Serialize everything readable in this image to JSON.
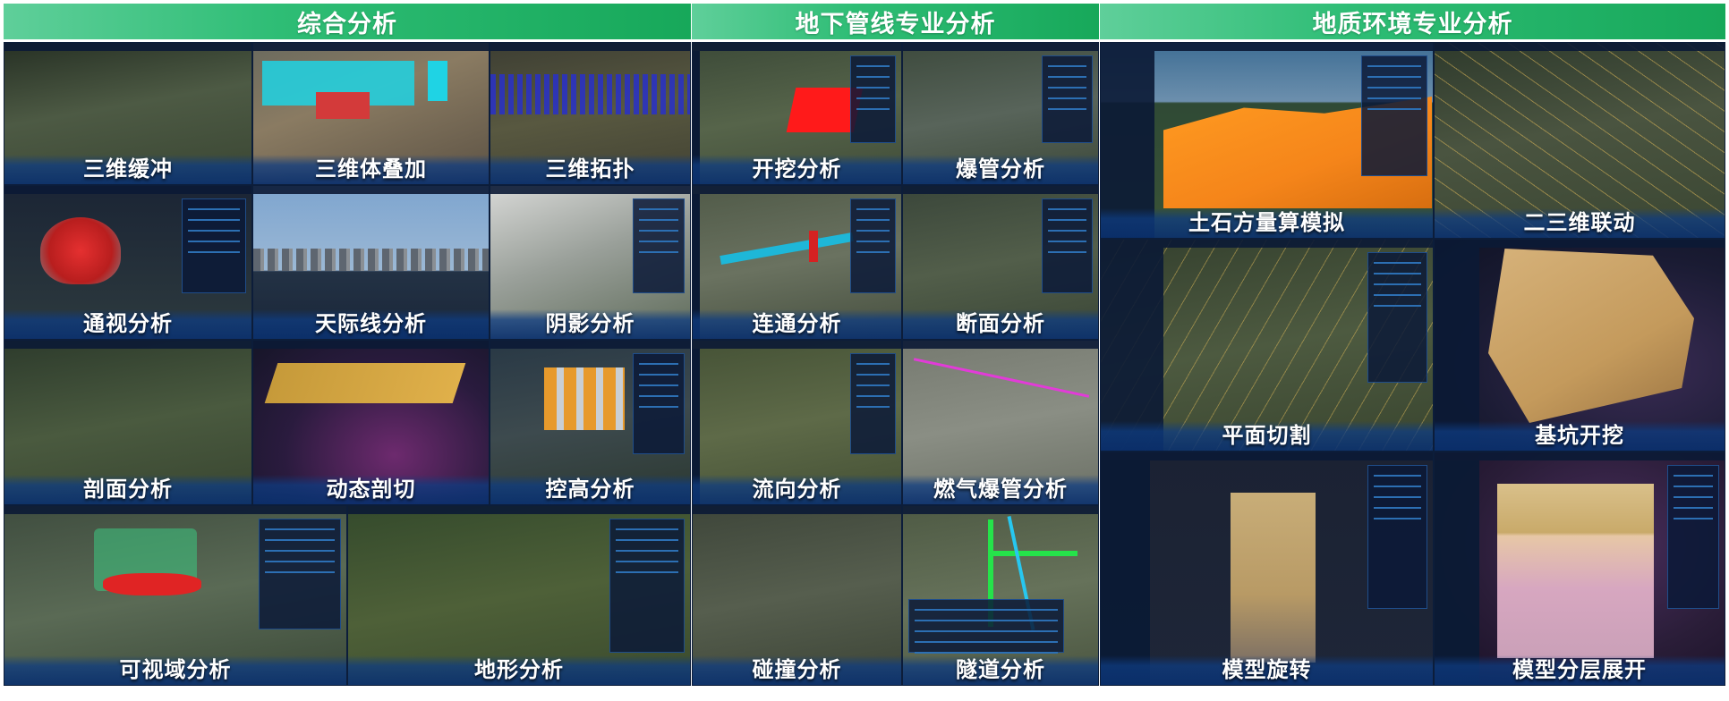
{
  "sections": [
    {
      "title": "综合分析",
      "color": "#2fbf78"
    },
    {
      "title": "地下管线专业分析",
      "color": "#23b56c"
    },
    {
      "title": "地质环境专业分析",
      "color": "#2cc07a"
    }
  ],
  "tiles": [
    {
      "id": "t01",
      "label": "三维缓冲",
      "bg": "#3f4a3a"
    },
    {
      "id": "t02",
      "label": "三维体叠加",
      "bg": "#6b5c48"
    },
    {
      "id": "t03",
      "label": "三维拓扑",
      "bg": "#4a4b38"
    },
    {
      "id": "t04",
      "label": "通视分析",
      "bg": "#1d2a3c"
    },
    {
      "id": "t05",
      "label": "天际线分析",
      "bg": "#6d8fb8"
    },
    {
      "id": "t06",
      "label": "阴影分析",
      "bg": "#7a7d78"
    },
    {
      "id": "t07",
      "label": "剖面分析",
      "bg": "#3d4a35"
    },
    {
      "id": "t08",
      "label": "动态剖切",
      "bg": "#2a1b3e"
    },
    {
      "id": "t09",
      "label": "控高分析",
      "bg": "#2b3a46"
    },
    {
      "id": "t10",
      "label": "可视域分析",
      "bg": "#4a5a48"
    },
    {
      "id": "t11",
      "label": "地形分析",
      "bg": "#3e5030"
    },
    {
      "id": "t12",
      "label": "开挖分析",
      "bg": "#495a40"
    },
    {
      "id": "t13",
      "label": "爆管分析",
      "bg": "#4a5648"
    },
    {
      "id": "t14",
      "label": "连通分析",
      "bg": "#4d5744"
    },
    {
      "id": "t15",
      "label": "断面分析",
      "bg": "#434d3e"
    },
    {
      "id": "t16",
      "label": "流向分析",
      "bg": "#4b5a3e"
    },
    {
      "id": "t17",
      "label": "燃气爆管分析",
      "bg": "#6f7468"
    },
    {
      "id": "t18",
      "label": "碰撞分析",
      "bg": "#444c40"
    },
    {
      "id": "t19",
      "label": "隧道分析",
      "bg": "#5a6650"
    },
    {
      "id": "t20",
      "label": "土石方量算模拟",
      "bg": "#3c6a8e"
    },
    {
      "id": "t21",
      "label": "二三维联动",
      "bg": "#3d4634"
    },
    {
      "id": "t22",
      "label": "平面切割",
      "bg": "#3f4a36"
    },
    {
      "id": "t23",
      "label": "基坑开挖",
      "bg": "#1a1b33"
    },
    {
      "id": "t24",
      "label": "模型旋转",
      "bg": "#1c2333"
    },
    {
      "id": "t25",
      "label": "模型分层展开",
      "bg": "#2a1d38"
    }
  ]
}
